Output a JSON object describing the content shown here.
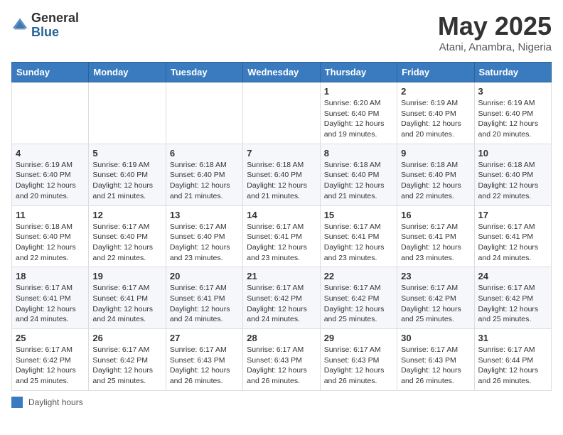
{
  "logo": {
    "general": "General",
    "blue": "Blue"
  },
  "title": "May 2025",
  "location": "Atani, Anambra, Nigeria",
  "legend_label": "Daylight hours",
  "days_of_week": [
    "Sunday",
    "Monday",
    "Tuesday",
    "Wednesday",
    "Thursday",
    "Friday",
    "Saturday"
  ],
  "weeks": [
    [
      {
        "day": "",
        "info": ""
      },
      {
        "day": "",
        "info": ""
      },
      {
        "day": "",
        "info": ""
      },
      {
        "day": "",
        "info": ""
      },
      {
        "day": "1",
        "info": "Sunrise: 6:20 AM\nSunset: 6:40 PM\nDaylight: 12 hours\nand 19 minutes."
      },
      {
        "day": "2",
        "info": "Sunrise: 6:19 AM\nSunset: 6:40 PM\nDaylight: 12 hours\nand 20 minutes."
      },
      {
        "day": "3",
        "info": "Sunrise: 6:19 AM\nSunset: 6:40 PM\nDaylight: 12 hours\nand 20 minutes."
      }
    ],
    [
      {
        "day": "4",
        "info": "Sunrise: 6:19 AM\nSunset: 6:40 PM\nDaylight: 12 hours\nand 20 minutes."
      },
      {
        "day": "5",
        "info": "Sunrise: 6:19 AM\nSunset: 6:40 PM\nDaylight: 12 hours\nand 21 minutes."
      },
      {
        "day": "6",
        "info": "Sunrise: 6:18 AM\nSunset: 6:40 PM\nDaylight: 12 hours\nand 21 minutes."
      },
      {
        "day": "7",
        "info": "Sunrise: 6:18 AM\nSunset: 6:40 PM\nDaylight: 12 hours\nand 21 minutes."
      },
      {
        "day": "8",
        "info": "Sunrise: 6:18 AM\nSunset: 6:40 PM\nDaylight: 12 hours\nand 21 minutes."
      },
      {
        "day": "9",
        "info": "Sunrise: 6:18 AM\nSunset: 6:40 PM\nDaylight: 12 hours\nand 22 minutes."
      },
      {
        "day": "10",
        "info": "Sunrise: 6:18 AM\nSunset: 6:40 PM\nDaylight: 12 hours\nand 22 minutes."
      }
    ],
    [
      {
        "day": "11",
        "info": "Sunrise: 6:18 AM\nSunset: 6:40 PM\nDaylight: 12 hours\nand 22 minutes."
      },
      {
        "day": "12",
        "info": "Sunrise: 6:17 AM\nSunset: 6:40 PM\nDaylight: 12 hours\nand 22 minutes."
      },
      {
        "day": "13",
        "info": "Sunrise: 6:17 AM\nSunset: 6:40 PM\nDaylight: 12 hours\nand 23 minutes."
      },
      {
        "day": "14",
        "info": "Sunrise: 6:17 AM\nSunset: 6:41 PM\nDaylight: 12 hours\nand 23 minutes."
      },
      {
        "day": "15",
        "info": "Sunrise: 6:17 AM\nSunset: 6:41 PM\nDaylight: 12 hours\nand 23 minutes."
      },
      {
        "day": "16",
        "info": "Sunrise: 6:17 AM\nSunset: 6:41 PM\nDaylight: 12 hours\nand 23 minutes."
      },
      {
        "day": "17",
        "info": "Sunrise: 6:17 AM\nSunset: 6:41 PM\nDaylight: 12 hours\nand 24 minutes."
      }
    ],
    [
      {
        "day": "18",
        "info": "Sunrise: 6:17 AM\nSunset: 6:41 PM\nDaylight: 12 hours\nand 24 minutes."
      },
      {
        "day": "19",
        "info": "Sunrise: 6:17 AM\nSunset: 6:41 PM\nDaylight: 12 hours\nand 24 minutes."
      },
      {
        "day": "20",
        "info": "Sunrise: 6:17 AM\nSunset: 6:41 PM\nDaylight: 12 hours\nand 24 minutes."
      },
      {
        "day": "21",
        "info": "Sunrise: 6:17 AM\nSunset: 6:42 PM\nDaylight: 12 hours\nand 24 minutes."
      },
      {
        "day": "22",
        "info": "Sunrise: 6:17 AM\nSunset: 6:42 PM\nDaylight: 12 hours\nand 25 minutes."
      },
      {
        "day": "23",
        "info": "Sunrise: 6:17 AM\nSunset: 6:42 PM\nDaylight: 12 hours\nand 25 minutes."
      },
      {
        "day": "24",
        "info": "Sunrise: 6:17 AM\nSunset: 6:42 PM\nDaylight: 12 hours\nand 25 minutes."
      }
    ],
    [
      {
        "day": "25",
        "info": "Sunrise: 6:17 AM\nSunset: 6:42 PM\nDaylight: 12 hours\nand 25 minutes."
      },
      {
        "day": "26",
        "info": "Sunrise: 6:17 AM\nSunset: 6:42 PM\nDaylight: 12 hours\nand 25 minutes."
      },
      {
        "day": "27",
        "info": "Sunrise: 6:17 AM\nSunset: 6:43 PM\nDaylight: 12 hours\nand 26 minutes."
      },
      {
        "day": "28",
        "info": "Sunrise: 6:17 AM\nSunset: 6:43 PM\nDaylight: 12 hours\nand 26 minutes."
      },
      {
        "day": "29",
        "info": "Sunrise: 6:17 AM\nSunset: 6:43 PM\nDaylight: 12 hours\nand 26 minutes."
      },
      {
        "day": "30",
        "info": "Sunrise: 6:17 AM\nSunset: 6:43 PM\nDaylight: 12 hours\nand 26 minutes."
      },
      {
        "day": "31",
        "info": "Sunrise: 6:17 AM\nSunset: 6:44 PM\nDaylight: 12 hours\nand 26 minutes."
      }
    ]
  ]
}
